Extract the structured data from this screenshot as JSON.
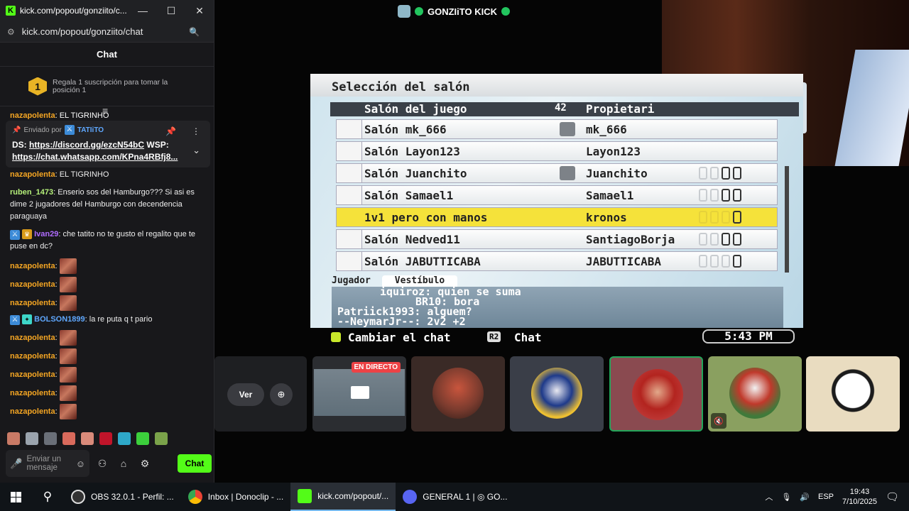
{
  "stream": {
    "title": "GONZIiTO KICK"
  },
  "chat_window": {
    "title": "kick.com/popout/gonziito/c...",
    "url": "kick.com/popout/gonziito/chat",
    "header": "Chat",
    "gift": {
      "badge": "1",
      "text": "Regala 1 suscripción para tomar la posición 1"
    },
    "pinned": {
      "sent_by_label": "Enviado por",
      "user": "TATIiTO",
      "line1_prefix": "DS:",
      "line1_link": "https://discord.gg/ezcN54bC",
      "line1_suffix": "WSP:",
      "line2_link": "https://chat.whatsapp.com/KPna4RBfj8..."
    },
    "partial_message": {
      "user": "nazapolenta",
      "text": ": EL TIGRINHO"
    },
    "messages": [
      {
        "user": "nazapolenta",
        "color": "#f5a623",
        "text": ": EL TIGRINHO"
      },
      {
        "user": "ruben_1473",
        "color": "#b5f07a",
        "text": ": Enserio sos del Hamburgo??? Si asi es dime 2 jugadores del Hamburgo con decendencia paraguaya"
      },
      {
        "user": "Ivan29",
        "color": "#b06cff",
        "text": ": che tatito no te gusto el regalito que te puse en dc?"
      },
      {
        "user": "BOLSON1899",
        "color": "#5fa8ff",
        "text": ": la re puta q t pario"
      }
    ],
    "emote_user": "nazapolenta",
    "input_placeholder": "Enviar un mensaje",
    "send_label": "Chat"
  },
  "game": {
    "title": "Selección del salón",
    "col_room": "Salón del juego",
    "room_count": "42",
    "col_owner": "Propietari",
    "rooms": [
      {
        "name": "Salón mk_666",
        "owner": "mk_666",
        "locked": true
      },
      {
        "name": "Salón Layon123",
        "owner": "Layon123",
        "locked": false
      },
      {
        "name": "Salón Juanchito",
        "owner": "Juanchito",
        "locked": true
      },
      {
        "name": "Salón Samael1",
        "owner": "Samael1",
        "locked": false
      },
      {
        "name": "1v1 pero con manos",
        "owner": "kronos",
        "locked": false,
        "selected": true
      },
      {
        "name": "Salón Nedved11",
        "owner": "SantiagoBorja",
        "locked": false
      },
      {
        "name": "Salón JABUTTICABA",
        "owner": "JABUTTICABA",
        "locked": false
      }
    ],
    "tab_player": "Jugador",
    "tab_lobby": "Vestíbulo",
    "chat_lines": [
      "iquiroz: quien se suma",
      "BR10: bora",
      "Patriick1993: alguem?",
      "--NeymarJr--: 2v2 +2"
    ],
    "footer_change_chat": "Cambiar el chat",
    "footer_r2": "R2",
    "footer_chat": "Chat",
    "clock": "5:43 PM"
  },
  "call": {
    "watch_label": "Ver",
    "live_badge": "EN DIRECTO"
  },
  "taskbar": {
    "items": [
      {
        "label": "OBS 32.0.1 - Perfil: ...",
        "color": "#333"
      },
      {
        "label": "Inbox | Donoclip - ...",
        "color": "#4285f4"
      },
      {
        "label": "kick.com/popout/...",
        "color": "#53fc18"
      },
      {
        "label": "GENERAL 1 | ◎ GO...",
        "color": "#5865f2"
      }
    ],
    "lang": "ESP",
    "time": "19:43",
    "date": "7/10/2025"
  }
}
